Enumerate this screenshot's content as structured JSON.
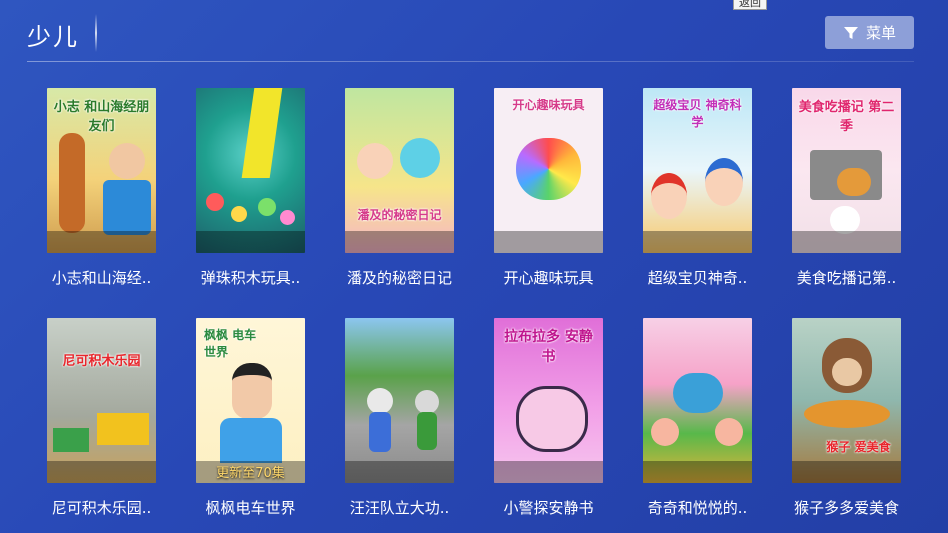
{
  "tooltip": "返回",
  "header": {
    "title": "少儿"
  },
  "menu_button": {
    "label": "菜单",
    "icon": "filter-icon"
  },
  "items": [
    {
      "title": "小志和山海经..",
      "poster_text": "小志 和山海经朋友们",
      "overlay": ""
    },
    {
      "title": "弹珠积木玩具..",
      "poster_text": "",
      "overlay": ""
    },
    {
      "title": "潘及的秘密日记",
      "poster_text": "潘及的秘密日记",
      "overlay": ""
    },
    {
      "title": "开心趣味玩具",
      "poster_text": "开心趣味玩具",
      "overlay": ""
    },
    {
      "title": "超级宝贝神奇..",
      "poster_text": "超级宝贝 神奇科学",
      "overlay": ""
    },
    {
      "title": "美食吃播记第..",
      "poster_text": "美食吃播记 第二季",
      "overlay": ""
    },
    {
      "title": "尼可积木乐园..",
      "poster_text": "尼可积木乐园",
      "overlay": ""
    },
    {
      "title": "枫枫电车世界",
      "poster_text": "枫枫 电车世界",
      "overlay": "更新至70集"
    },
    {
      "title": "汪汪队立大功..",
      "poster_text": "",
      "overlay": ""
    },
    {
      "title": "小警探安静书",
      "poster_text": "拉布拉多 安静书",
      "overlay": ""
    },
    {
      "title": "奇奇和悦悦的..",
      "poster_text": "",
      "overlay": ""
    },
    {
      "title": "猴子多多爱美食",
      "poster_text": "猴子 爱美食",
      "overlay": ""
    }
  ],
  "colors": {
    "background": "#2848b6",
    "menu_button": "#8d9fd8",
    "overlay_text": "#ffd86b"
  }
}
